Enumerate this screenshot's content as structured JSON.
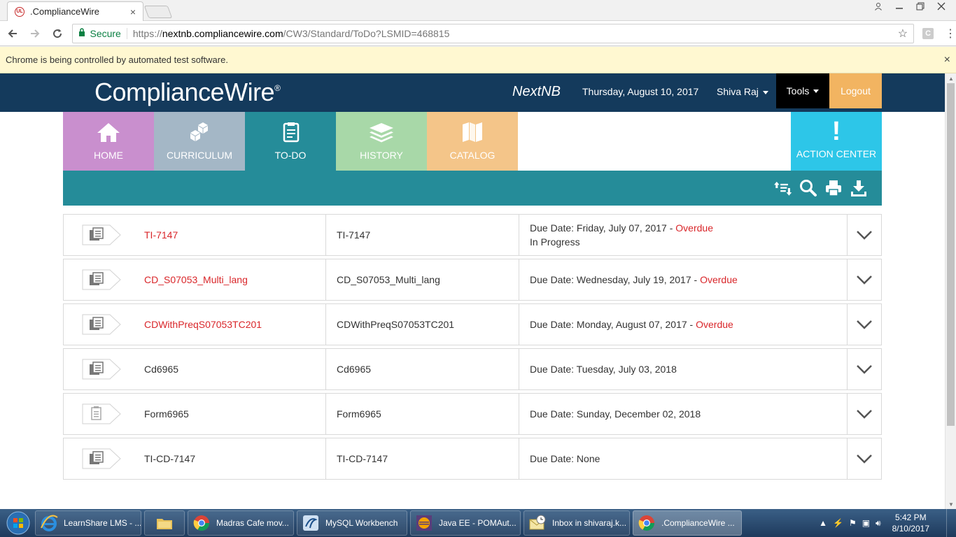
{
  "browser": {
    "tab_title": ".ComplianceWire",
    "tab_close": "×",
    "secure_label": "Secure",
    "url_scheme": "https://",
    "url_host": "nextnb.compliancewire.com",
    "url_path": "/CW3/Standard/ToDo?LSMID=468815",
    "ext_letter": "C",
    "infobar_text": "Chrome is being controlled by automated test software.",
    "infobar_close": "×"
  },
  "header": {
    "brand": "ComplianceWire",
    "brand_mark": "®",
    "site_name": "NextNB",
    "date": "Thursday, August 10, 2017",
    "user": "Shiva Raj",
    "tools": "Tools",
    "logout": "Logout"
  },
  "nav": {
    "home": "HOME",
    "curriculum": "CURRICULUM",
    "todo": "TO-DO",
    "history": "HISTORY",
    "catalog": "CATALOG",
    "action_center": "ACTION CENTER",
    "action_mark": "!"
  },
  "todo_items": [
    {
      "name": "TI-7147",
      "code": "TI-7147",
      "due_label": "Due Date: Friday, July 07, 2017",
      "sep": " - ",
      "status": "Overdue",
      "progress": "In Progress"
    },
    {
      "name": "CD_S07053_Multi_lang",
      "code": "CD_S07053_Multi_lang",
      "due_label": "Due Date: Wednesday, July 19, 2017",
      "sep": " - ",
      "status": "Overdue"
    },
    {
      "name": "CDWithPreqS07053TC201",
      "code": "CDWithPreqS07053TC201",
      "due_label": "Due Date: Monday, August 07, 2017",
      "sep": " - ",
      "status": "Overdue"
    },
    {
      "name": "Cd6965",
      "code": "Cd6965",
      "due_label": "Due Date: Tuesday, July 03, 2018"
    },
    {
      "name": "Form6965",
      "code": "Form6965",
      "due_label": "Due Date: Sunday, December 02, 2018"
    },
    {
      "name": "TI-CD-7147",
      "code": "TI-CD-7147",
      "due_label": "Due Date: None"
    }
  ],
  "taskbar": {
    "items": [
      "LearnShare LMS - ...",
      "",
      "Madras Cafe mov...",
      "MySQL Workbench",
      "Java EE - POMAut...",
      "Inbox in shivaraj.k...",
      ".ComplianceWire ..."
    ],
    "time": "5:42 PM",
    "date": "8/10/2017"
  },
  "colors": {
    "header_bg": "#143a5c",
    "home": "#c98fce",
    "curriculum": "#a4b7c6",
    "todo": "#258c99",
    "history": "#a8d8a8",
    "catalog": "#f4c589",
    "action_center": "#2dc6e8",
    "logout": "#f2b461",
    "overdue": "#d9262a"
  }
}
